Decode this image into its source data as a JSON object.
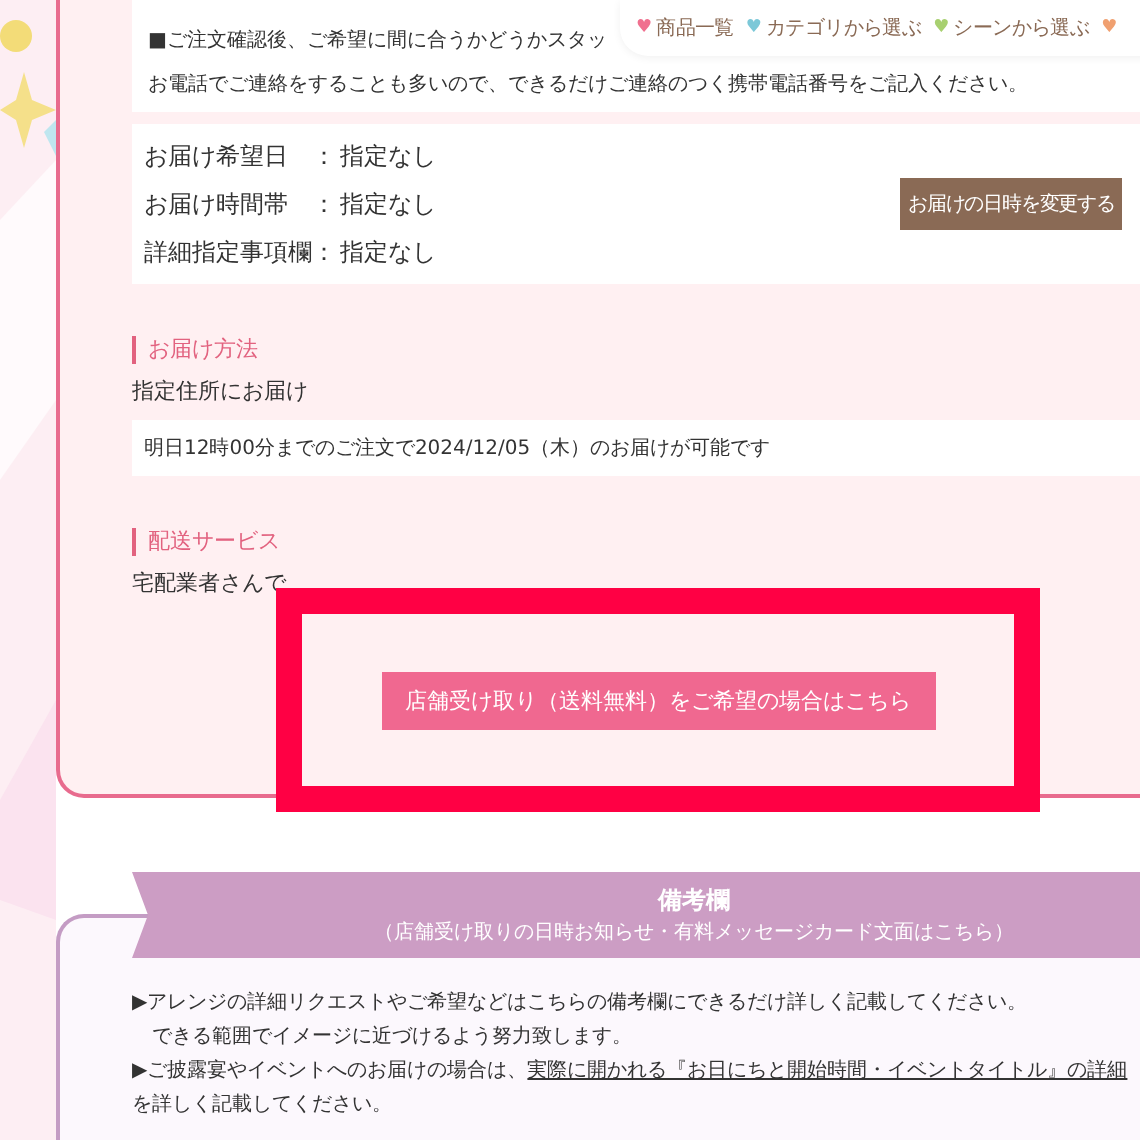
{
  "nav": [
    {
      "icon": "♥",
      "label": "商品一覧",
      "color": "#f0708f"
    },
    {
      "icon": "♥",
      "label": "カテゴリから選ぶ",
      "color": "#7cc8d8"
    },
    {
      "icon": "♥",
      "label": "シーンから選ぶ",
      "color": "#a8d070"
    },
    {
      "icon": "♥",
      "color": "#f0a070"
    }
  ],
  "notice_lines": [
    "■ご注文確認後、ご希望に間に合うかどうかスタッ",
    "お電話でご連絡をすることも多いので、できるだけご連絡のつく携帯電話番号をご記入ください。"
  ],
  "delivery_rows": [
    {
      "label": "お届け希望日",
      "separator": "：",
      "value": "指定なし"
    },
    {
      "label": "お届け時間帯",
      "separator": "：",
      "value": "指定なし"
    },
    {
      "label": "詳細指定事項欄",
      "separator": "：",
      "value": "指定なし"
    }
  ],
  "change_button": "お届けの日時を変更する",
  "method": {
    "heading": "お届け方法",
    "value": "指定住所にお届け",
    "note": "明日12時00分までのご注文で2024/12/05（木）のお届けが可能です"
  },
  "service": {
    "heading": "配送サービス",
    "value": "宅配業者さんで"
  },
  "store_pickup_button": "店舗受け取り（送料無料）をご希望の場合はこちら",
  "remarks": {
    "title": "備考欄",
    "subtitle": "（店舗受け取りの日時お知らせ・有料メッセージカード文面はこちら）",
    "lines": [
      "▶アレンジの詳細リクエストやご希望などはこちらの備考欄にできるだけ詳しく記載してください。",
      "　できる範囲でイメージに近づけるよう努力致します。"
    ],
    "event_line": {
      "before": "▶ご披露宴やイベントへのお届けの場合は、",
      "underlined": "実際に開かれる『お日にちと開始時間・イベントタイトル』の詳細",
      "after": "を詳しく記載してください。"
    }
  }
}
